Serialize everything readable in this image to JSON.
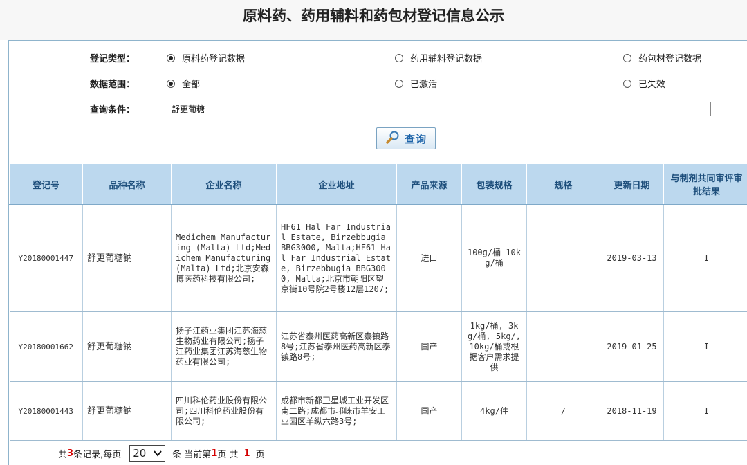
{
  "page_title": "原料药、药用辅料和药包材登记信息公示",
  "form": {
    "type_label": "登记类型：",
    "type_options": [
      {
        "label": "原料药登记数据",
        "selected": true
      },
      {
        "label": "药用辅料登记数据",
        "selected": false
      },
      {
        "label": "药包材登记数据",
        "selected": false
      }
    ],
    "range_label": "数据范围：",
    "range_options": [
      {
        "label": "全部",
        "selected": true
      },
      {
        "label": "已激活",
        "selected": false
      },
      {
        "label": "已失效",
        "selected": false
      }
    ],
    "query_label": "查询条件：",
    "query_value": "舒更葡糖",
    "search_button": "查询",
    "search_icon": "magnifier-icon"
  },
  "table": {
    "headers": [
      "登记号",
      "品种名称",
      "企业名称",
      "企业地址",
      "产品来源",
      "包装规格",
      "规格",
      "更新日期",
      "与制剂共同审评审批结果"
    ],
    "rows": [
      {
        "reg_no": "Y20180001447",
        "product": "舒更葡糖钠",
        "company": "Medichem Manufacturing (Malta) Ltd;Medichem Manufacturing (Malta) Ltd;北京安森博医药科技有限公司;",
        "address": "HF61 Hal Far Industrial Estate, Birzebbugia BBG3000, Malta;HF61 Hal Far Industrial Estate, Birzebbugia BBG3000, Malta;北京市朝阳区望京街10号院2号楼12层1207;",
        "source": "进口",
        "package": "100g/桶-10kg/桶",
        "spec": "",
        "date": "2019-03-13",
        "result": "I"
      },
      {
        "reg_no": "Y20180001662",
        "product": "舒更葡糖钠",
        "company": "扬子江药业集团江苏海慈生物药业有限公司;扬子江药业集团江苏海慈生物药业有限公司;",
        "address": "江苏省泰州医药高新区泰镇路8号;江苏省泰州医药高新区泰镇路8号;",
        "source": "国产",
        "package": "1kg/桶, 3kg/桶, 5kg/, 10kg/桶或根据客户需求提供",
        "spec": "",
        "date": "2019-01-25",
        "result": "I"
      },
      {
        "reg_no": "Y20180001443",
        "product": "舒更葡糖钠",
        "company": "四川科伦药业股份有限公司;四川科伦药业股份有限公司;",
        "address": "成都市新都卫星城工业开发区南二路;成都市邛崃市羊安工业园区羊纵六路3号;",
        "source": "国产",
        "package": "4kg/件",
        "spec": "/",
        "date": "2018-11-19",
        "result": "I"
      }
    ]
  },
  "pager": {
    "prefix": "共",
    "total": "3",
    "mid1": "条记录,每页",
    "page_size": "20",
    "mid2": "条 当前第",
    "current": "1",
    "mid3": "页 共",
    "pages": "1",
    "suffix": "页"
  }
}
